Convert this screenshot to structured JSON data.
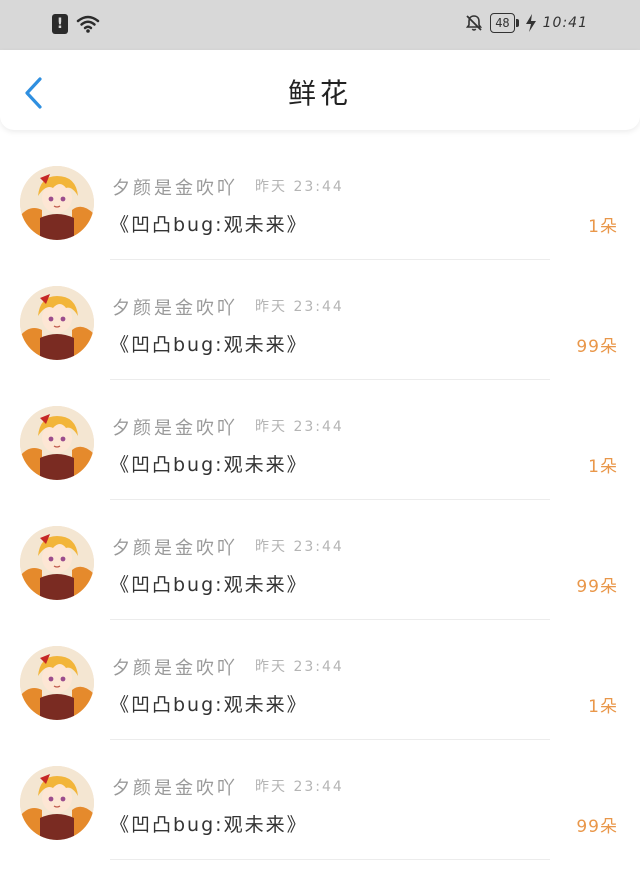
{
  "status_bar": {
    "alert": "!",
    "battery": "48",
    "time": "10:41"
  },
  "header": {
    "title": "鲜花"
  },
  "items": [
    {
      "username": "夕颜是金吹吖",
      "time": "昨天 23:44",
      "message": "《凹凸bug:观未来》",
      "count": "1朵"
    },
    {
      "username": "夕颜是金吹吖",
      "time": "昨天 23:44",
      "message": "《凹凸bug:观未来》",
      "count": "99朵"
    },
    {
      "username": "夕颜是金吹吖",
      "time": "昨天 23:44",
      "message": "《凹凸bug:观未来》",
      "count": "1朵"
    },
    {
      "username": "夕颜是金吹吖",
      "time": "昨天 23:44",
      "message": "《凹凸bug:观未来》",
      "count": "99朵"
    },
    {
      "username": "夕颜是金吹吖",
      "time": "昨天 23:44",
      "message": "《凹凸bug:观未来》",
      "count": "1朵"
    },
    {
      "username": "夕颜是金吹吖",
      "time": "昨天 23:44",
      "message": "《凹凸bug:观未来》",
      "count": "99朵"
    }
  ],
  "colors": {
    "accent": "#2f8fe0",
    "count": "#e9974a",
    "status_bar_bg": "#d8d8d8"
  }
}
